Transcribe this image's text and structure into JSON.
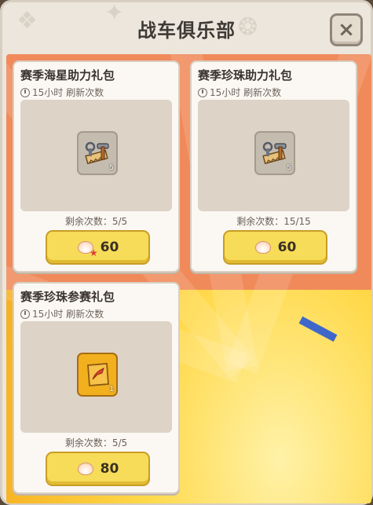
{
  "header": {
    "title": "战车俱乐部",
    "close_label": "×"
  },
  "cards": [
    {
      "title": "赛季海星助力礼包",
      "refresh_text": "15小时 刷新次数",
      "item_icon": "tools-saw-hammer-icon",
      "item_count": "5",
      "remaining_text": "剩余次数：5/5",
      "currency_icon": "starfish-shell-icon",
      "price": "60"
    },
    {
      "title": "赛季珍珠助力礼包",
      "refresh_text": "15小时 刷新次数",
      "item_icon": "tools-saw-hammer-icon",
      "item_count": "5",
      "remaining_text": "剩余次数：15/15",
      "currency_icon": "pearl-shell-icon",
      "price": "60"
    },
    {
      "title": "赛季珍珠参赛礼包",
      "refresh_text": "15小时 刷新次数",
      "item_icon": "race-ticket-icon",
      "item_count": "1",
      "remaining_text": "剩余次数：5/5",
      "currency_icon": "pearl-shell-icon",
      "price": "80"
    }
  ],
  "colors": {
    "panel_bg": "#ece6dc",
    "button_yellow": "#f6dc58",
    "background_orange": "#f19a22",
    "accent_red": "#e23b3b"
  }
}
